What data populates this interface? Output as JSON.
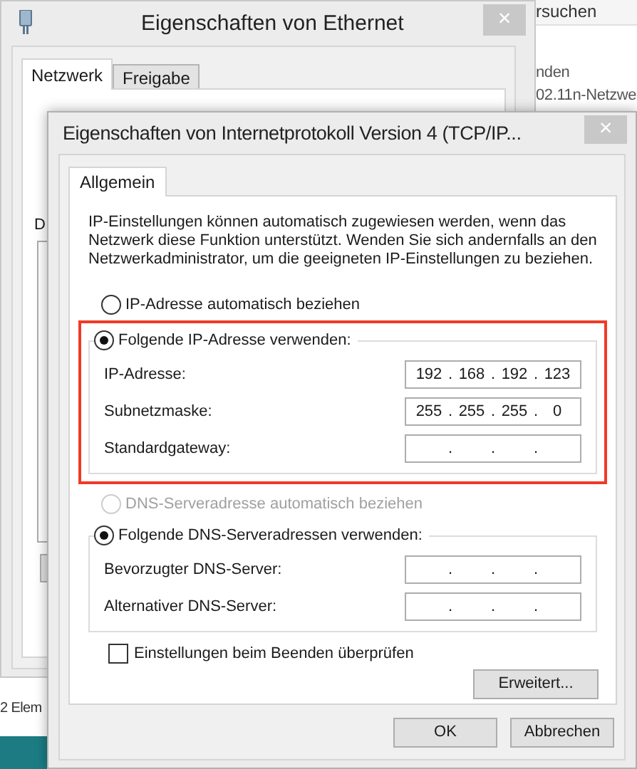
{
  "background_window": {
    "search_text": "rsuchen",
    "lines": [
      "nden",
      "02.11n-Netzwe"
    ],
    "status_bar": "2 Elem"
  },
  "ethernet_window": {
    "title": "Eigenschaften von Ethernet",
    "close": "×",
    "tabs": [
      {
        "label": "Netzwerk",
        "selected": true
      },
      {
        "label": "Freigabe",
        "selected": false
      }
    ],
    "partial_label": "D"
  },
  "ipv4_window": {
    "title": "Eigenschaften von Internetprotokoll Version 4 (TCP/IP...",
    "close": "×",
    "tabs": [
      {
        "label": "Allgemein",
        "selected": true
      }
    ],
    "description": "IP-Einstellungen können automatisch zugewiesen werden, wenn das Netzwerk diese Funktion unterstützt. Wenden Sie sich andernfalls an den Netzwerkadministrator, um die geeigneten IP-Einstellungen zu beziehen.",
    "ip_auto": {
      "label": "IP-Adresse automatisch beziehen",
      "selected": false,
      "disabled": false
    },
    "ip_static": {
      "label": "Folgende IP-Adresse verwenden:",
      "selected": true,
      "disabled": false,
      "highlighted": true,
      "fields": [
        {
          "label": "IP-Adresse:",
          "octets": [
            "192",
            "168",
            "192",
            "123"
          ],
          "dots": [
            ".",
            ".",
            "."
          ]
        },
        {
          "label": "Subnetzmaske:",
          "octets": [
            "255",
            "255",
            "255",
            "0"
          ],
          "dots": [
            ".",
            ".",
            "."
          ]
        },
        {
          "label": "Standardgateway:",
          "dots": [
            ".",
            ".",
            "."
          ]
        }
      ]
    },
    "dns_auto": {
      "label": "DNS-Serveradresse automatisch beziehen",
      "selected": false,
      "disabled": true
    },
    "dns_static": {
      "label": "Folgende DNS-Serveradressen verwenden:",
      "selected": true,
      "disabled": false,
      "highlighted": false,
      "fields": [
        {
          "label": "Bevorzugter DNS-Server:",
          "dots": [
            ".",
            ".",
            "."
          ]
        },
        {
          "label": "Alternativer DNS-Server:",
          "dots": [
            ".",
            ".",
            "."
          ]
        }
      ]
    },
    "validate": {
      "label": "Einstellungen beim Beenden überprüfen",
      "checked": false
    },
    "advanced_button": "Erweitert...",
    "buttons": [
      "OK",
      "Abbrechen"
    ]
  }
}
